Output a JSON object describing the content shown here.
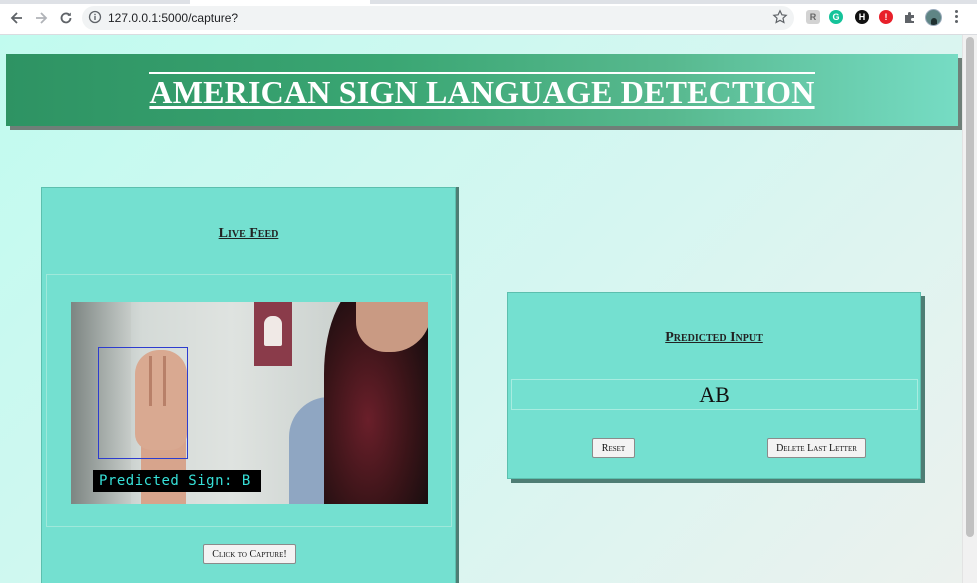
{
  "browser": {
    "url": "127.0.0.1:5000/capture?",
    "extensions": [
      "reader-icon",
      "grammarly-icon",
      "headphones-icon",
      "adblock-icon",
      "puzzle-icon"
    ]
  },
  "header": {
    "title": "AMERICAN SIGN LANGUAGE DETECTION"
  },
  "live_feed": {
    "title": "Live Feed",
    "overlay_text": "Predicted Sign: B",
    "capture_button": "Click to Capture!"
  },
  "predicted_input": {
    "title": "Predicted Input",
    "value": "AB",
    "reset_button": "Reset",
    "delete_button": "Delete Last Letter"
  },
  "colors": {
    "page_bg": "#c4faf0",
    "banner_start": "#2e9363",
    "banner_end": "#76dcc4",
    "card_bg": "#74e0d0",
    "overlay_text": "#36e0d8",
    "detection_box": "#2d3ccf"
  }
}
